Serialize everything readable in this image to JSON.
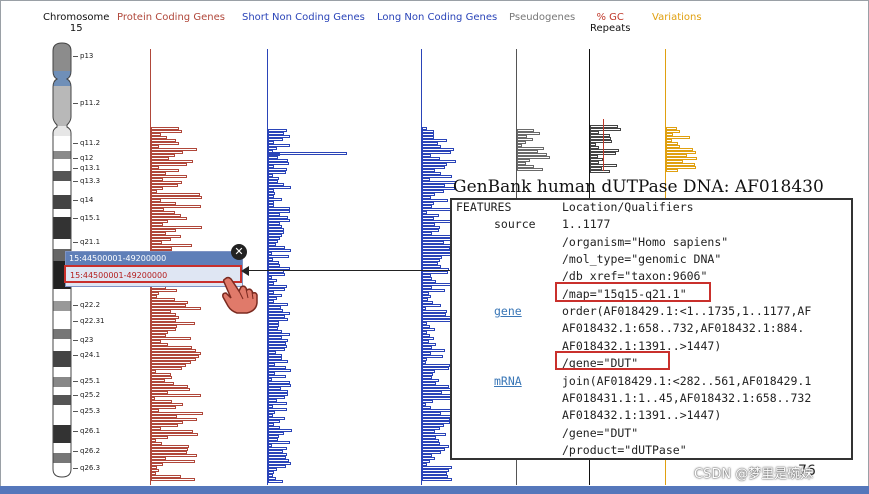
{
  "headers": {
    "chromosome": "Chromosome",
    "chromosome_number": "15",
    "protein_coding": "Protein Coding Genes",
    "short_non_coding": "Short Non Coding Genes",
    "long_non_coding": "Long Non Coding Genes",
    "pseudogenes": "Pseudogenes",
    "gc": "% GC",
    "repeats": "Repeats",
    "variations": "Variations"
  },
  "colors": {
    "protein_coding": "#b0473a",
    "short_non_coding": "#2a44b8",
    "long_non_coding": "#2a44b8",
    "pseudogenes": "#6a6a6a",
    "gc": "#c0392b",
    "variations": "#e0a010"
  },
  "bands": [
    {
      "label": "p13"
    },
    {
      "label": "p11.2"
    },
    {
      "label": "q11.2"
    },
    {
      "label": "q12"
    },
    {
      "label": "q13.1"
    },
    {
      "label": "q13.3"
    },
    {
      "label": "q14"
    },
    {
      "label": "q15.1"
    },
    {
      "label": "q21.1"
    },
    {
      "label": "q22.2"
    },
    {
      "label": "q22.31"
    },
    {
      "label": "q23"
    },
    {
      "label": "q24.1"
    },
    {
      "label": "q25.1"
    },
    {
      "label": "q25.2"
    },
    {
      "label": "q25.3"
    },
    {
      "label": "q26.1"
    },
    {
      "label": "q26.2"
    },
    {
      "label": "q26.3"
    }
  ],
  "popup": {
    "title": "15:44500001-49200000",
    "link": "15:44500001-49200000",
    "close_icon": "close-icon",
    "cursor_icon": "hand-pointer-icon"
  },
  "genbank": {
    "title": "GenBank human dUTPase DNA: AF018430",
    "lines": [
      {
        "key": "FEATURES",
        "value": "Location/Qualifiers"
      },
      {
        "key": "source",
        "value": "1..1177"
      },
      {
        "key": "",
        "value": "/organism=\"Homo sapiens\""
      },
      {
        "key": "",
        "value": "/mol_type=\"genomic DNA\""
      },
      {
        "key": "",
        "value": "/db_xref=\"taxon:9606\""
      },
      {
        "key": "",
        "value": "/map=\"15q15-q21.1\""
      },
      {
        "key": "gene",
        "value": "order(AF018429.1:<1..1735,1..1177,AF"
      },
      {
        "key": "",
        "value": "AF018432.1:658..732,AF018432.1:884."
      },
      {
        "key": "",
        "value": "AF018432.1:1391..>1447)"
      },
      {
        "key": "",
        "value": "/gene=\"DUT\""
      },
      {
        "key": "mRNA",
        "value": "join(AF018429.1:<282..561,AF018429.1"
      },
      {
        "key": "",
        "value": "AF018431.1:1..45,AF018432.1:658..732"
      },
      {
        "key": "",
        "value": "AF018432.1:1391..>1447)"
      },
      {
        "key": "",
        "value": "/gene=\"DUT\""
      },
      {
        "key": "",
        "value": "/product=\"dUTPase\""
      }
    ]
  },
  "watermark": "CSDN @梦里是碗妹",
  "page_number": "76"
}
